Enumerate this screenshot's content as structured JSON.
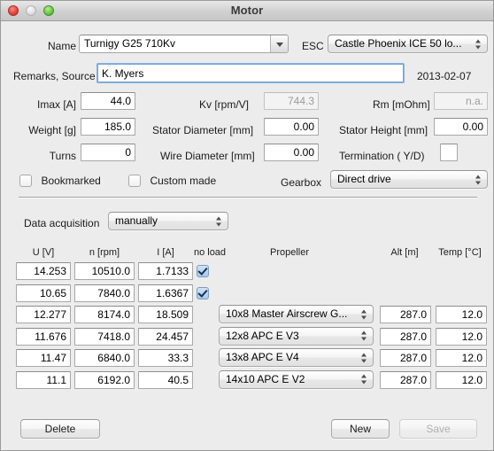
{
  "window": {
    "title": "Motor",
    "traffic_lights": [
      "close-button",
      "minimize-button",
      "zoom-button"
    ]
  },
  "form": {
    "name_label": "Name",
    "name_value": "Turnigy G25 710Kv",
    "esc_label": "ESC",
    "esc_value": "Castle Phoenix ICE 50 lo...",
    "remarks_label": "Remarks, Source",
    "remarks_value": "K. Myers",
    "date_value": "2013-02-07",
    "imax_label": "Imax [A]",
    "imax_value": "44.0",
    "kv_label": "Kv [rpm/V]",
    "kv_value": "744.3",
    "rm_label": "Rm [mOhm]",
    "rm_value": "n.a.",
    "weight_label": "Weight [g]",
    "weight_value": "185.0",
    "stator_diameter_label": "Stator Diameter [mm]",
    "stator_diameter_value": "0.00",
    "stator_height_label": "Stator Height [mm]",
    "stator_height_value": "0.00",
    "turns_label": "Turns",
    "turns_value": "0",
    "wire_diameter_label": "Wire Diameter [mm]",
    "wire_diameter_value": "0.00",
    "termination_label": "Termination ( Y/D)",
    "termination_value": "",
    "bookmarked_label": "Bookmarked",
    "bookmarked_checked": false,
    "custom_made_label": "Custom made",
    "custom_made_checked": false,
    "gearbox_label": "Gearbox",
    "gearbox_value": "Direct drive"
  },
  "acquisition": {
    "label": "Data acquisition",
    "value": "manually"
  },
  "table": {
    "headers": {
      "u": "U [V]",
      "n": "n [rpm]",
      "i": "I [A]",
      "no_load": "no load",
      "propeller": "Propeller",
      "alt": "Alt [m]",
      "temp": "Temp [°C]"
    },
    "rows": [
      {
        "u": "14.253",
        "n": "10510.0",
        "i": "1.7133",
        "no_load": true,
        "propeller": "",
        "alt": "",
        "temp": ""
      },
      {
        "u": "10.65",
        "n": "7840.0",
        "i": "1.6367",
        "no_load": true,
        "propeller": "",
        "alt": "",
        "temp": ""
      },
      {
        "u": "12.277",
        "n": "8174.0",
        "i": "18.509",
        "no_load": false,
        "propeller": "10x8 Master Airscrew G...",
        "alt": "287.0",
        "temp": "12.0"
      },
      {
        "u": "11.676",
        "n": "7418.0",
        "i": "24.457",
        "no_load": false,
        "propeller": "12x8 APC E V3",
        "alt": "287.0",
        "temp": "12.0"
      },
      {
        "u": "11.47",
        "n": "6840.0",
        "i": "33.3",
        "no_load": false,
        "propeller": "13x8 APC E V4",
        "alt": "287.0",
        "temp": "12.0"
      },
      {
        "u": "11.1",
        "n": "6192.0",
        "i": "40.5",
        "no_load": false,
        "propeller": "14x10 APC E V2",
        "alt": "287.0",
        "temp": "12.0"
      }
    ]
  },
  "footer": {
    "delete_label": "Delete",
    "new_label": "New",
    "save_label": "Save",
    "save_disabled": true
  }
}
